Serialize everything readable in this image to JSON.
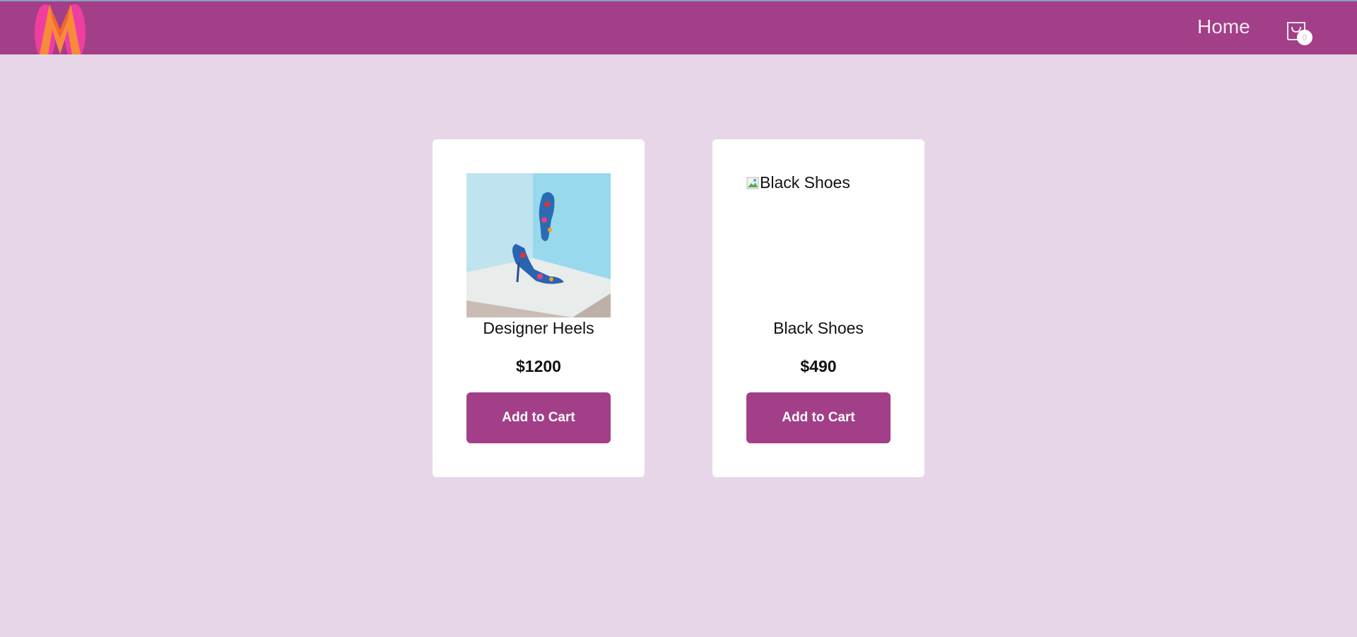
{
  "header": {
    "nav_home": "Home",
    "cart_count": "0",
    "logo_icon": "myntra-logo-icon",
    "cart_icon": "shopping-bag-icon"
  },
  "products": [
    {
      "name": "Designer Heels",
      "price": "$1200",
      "button_label": "Add to Cart",
      "image_alt": ""
    },
    {
      "name": "Black Shoes",
      "price": "$490",
      "button_label": "Add to Cart",
      "image_alt": "Black Shoes"
    }
  ],
  "colors": {
    "brand": "#a23f88",
    "page_background": "#e6d6e8",
    "card_background": "#ffffff"
  }
}
